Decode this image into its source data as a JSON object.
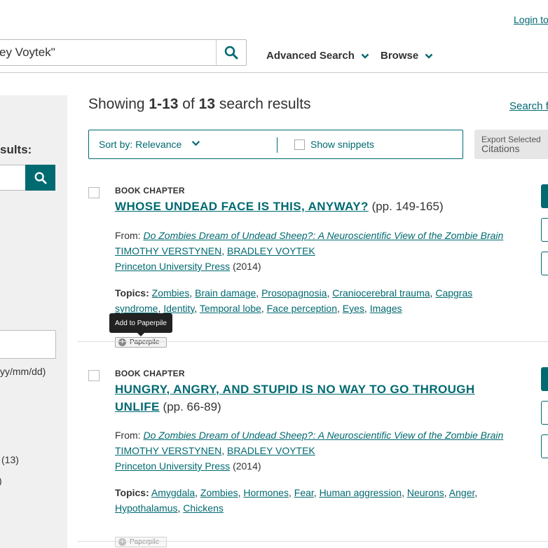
{
  "header": {
    "login_label": "Login to",
    "search_value": "ey Voytek\"",
    "nav": [
      {
        "label": "Advanced Search"
      },
      {
        "label": "Browse"
      }
    ]
  },
  "sidebar": {
    "heading": "sults:",
    "date_format": "yy/mm/dd)",
    "counts": [
      "(13)",
      ")"
    ]
  },
  "main": {
    "showing_prefix": "Showing",
    "showing_range": "1-13",
    "showing_of": "of",
    "showing_total": "13",
    "showing_suffix": "search results",
    "search_for_label": "Search fo",
    "sort_label": "Sort by: Relevance",
    "snippets_label": "Show snippets",
    "export_line1": "Export Selected",
    "export_line2": "Citations"
  },
  "tooltip": "Add to Paperpile",
  "results": [
    {
      "type": "BOOK CHAPTER",
      "title": "WHOSE UNDEAD FACE IS THIS, ANYWAY?",
      "pages": "(pp. 149-165)",
      "from_label": "From:",
      "book": "Do Zombies Dream of Undead Sheep?: A Neuroscientific View of the Zombie Brain",
      "authors": [
        "TIMOTHY VERSTYNEN",
        "BRADLEY VOYTEK"
      ],
      "publisher": "Princeton University Press",
      "year": "(2014)",
      "topics_label": "Topics:",
      "topics": [
        "Zombies",
        "Brain damage",
        "Prosopagnosia",
        "Craniocerebral trauma",
        "Capgras syndrome",
        "Identity",
        "Temporal lobe",
        "Face perception",
        "Eyes",
        "Images"
      ],
      "paperpile_label": "Paperpile"
    },
    {
      "type": "BOOK CHAPTER",
      "title": "HUNGRY, ANGRY, AND STUPID IS NO WAY TO GO THROUGH UNLIFE",
      "pages": "(pp. 66-89)",
      "from_label": "From:",
      "book": "Do Zombies Dream of Undead Sheep?: A Neuroscientific View of the Zombie Brain",
      "authors": [
        "TIMOTHY VERSTYNEN",
        "BRADLEY VOYTEK"
      ],
      "publisher": "Princeton University Press",
      "year": "(2014)",
      "topics_label": "Topics:",
      "topics": [
        "Amygdala",
        "Zombies",
        "Hormones",
        "Fear",
        "Human aggression",
        "Neurons",
        "Anger",
        "Hypothalamus",
        "Chickens"
      ],
      "paperpile_label": "Paperpile"
    }
  ],
  "colors": {
    "accent": "#006a71",
    "sidebar_bg": "#f0f0f0",
    "text": "#333333"
  }
}
